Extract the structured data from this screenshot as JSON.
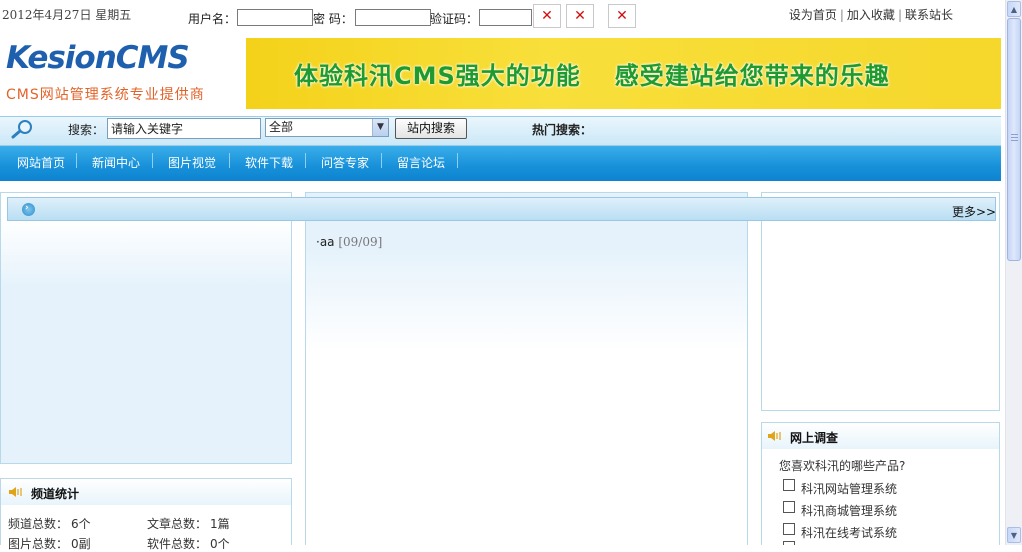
{
  "topbar": {
    "date": "2012年4月27日 星期五",
    "username_label": "用户名：",
    "password_label": "密 码：",
    "captcha_label": "验证码：",
    "links": [
      "设为首页",
      "加入收藏",
      "联系站长"
    ]
  },
  "header": {
    "logo_text": "KesionCMS",
    "logo_subtitle": "CMS网站管理系统专业提供商",
    "banner_left": "体验科汛CMS强大的功能",
    "banner_right": "感受建站给您带来的乐趣"
  },
  "search": {
    "label": "搜索：",
    "value": "请输入关键字",
    "scope": "全部",
    "button": "站内搜索",
    "hot_label": "热门搜索："
  },
  "nav": {
    "items": [
      "网站首页",
      "新闻中心",
      "图片视觉",
      "软件下载",
      "问答专家",
      "留言论坛"
    ]
  },
  "content": {
    "more_label": "更多>>",
    "news_item": {
      "title": "·aa",
      "date": "[09/09]"
    }
  },
  "stats": {
    "title": "频道统计",
    "rows": [
      {
        "label": "频道总数：",
        "value": "6个",
        "label2": "文章总数：",
        "value2": "1篇"
      },
      {
        "label": "图片总数：",
        "value": "0副",
        "label2": "软件总数：",
        "value2": "0个"
      }
    ]
  },
  "survey": {
    "title": "网上调查",
    "question": "您喜欢科汛的哪些产品?",
    "options": [
      "科汛网站管理系统",
      "科汛商城管理系统",
      "科汛在线考试系统"
    ]
  },
  "colors": {
    "nav_bg": "#1790d9",
    "banner_bg": "#f6d72b",
    "banner_text": "#1f9a2f",
    "logo_blue": "#1e5fae",
    "logo_orange": "#e2632a",
    "error_x": "#d01010"
  },
  "icons": [
    "magnifier-icon",
    "close-x-icon",
    "speaker-icon",
    "circle-arrow-icon"
  ]
}
